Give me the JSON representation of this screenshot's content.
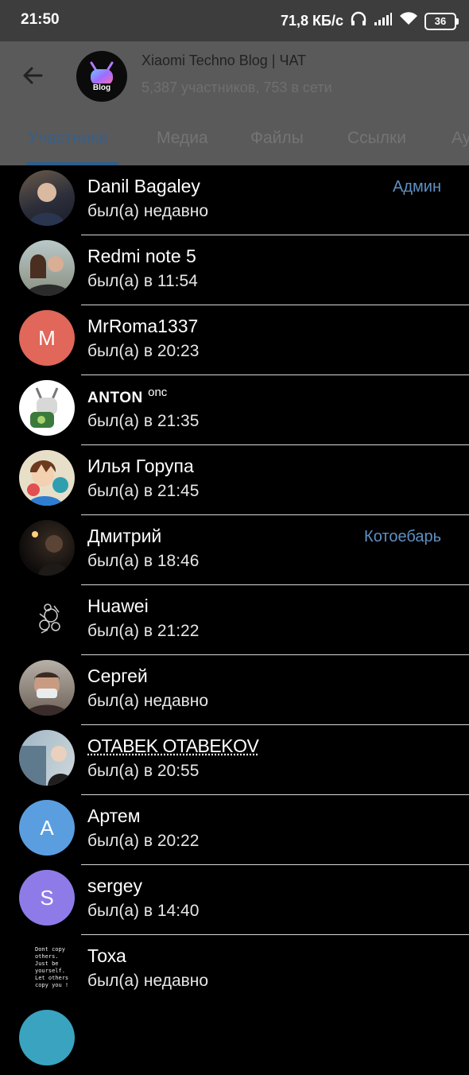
{
  "status_bar": {
    "time": "21:50",
    "network_speed": "71,8 КБ/с",
    "battery_level": "36",
    "icons": [
      "headphones-icon",
      "signal-icon",
      "wifi-icon",
      "battery-icon"
    ]
  },
  "header": {
    "avatar_text": "Blog",
    "title": "Xiaomi Techno Blog | ЧАТ",
    "subtitle": "5,387 участников, 753 в сети"
  },
  "tabs": [
    {
      "label": "Участники",
      "active": true
    },
    {
      "label": "Медиа"
    },
    {
      "label": "Файлы"
    },
    {
      "label": "Ссылки"
    },
    {
      "label": "Ау"
    }
  ],
  "members": [
    {
      "name": "Danil Bagaley",
      "status": "был(а) недавно",
      "role": "Админ"
    },
    {
      "name": "Redmi note 5",
      "status": "был(а) в 11:54",
      "role": ""
    },
    {
      "name": "MrRoma1337",
      "status": "был(а) в 20:23",
      "role": "",
      "initial": "M"
    },
    {
      "name": "ANTON",
      "name_sup": "onc",
      "status": "был(а) в 21:35",
      "role": ""
    },
    {
      "name": "Илья Горупа",
      "status": "был(а) в 21:45",
      "role": ""
    },
    {
      "name": "Дмитрий",
      "status": "был(а) в 18:46",
      "role": "Котоебарь"
    },
    {
      "name": "Huawei",
      "status": "был(а) в 21:22",
      "role": ""
    },
    {
      "name": "Сергей",
      "status": "был(а) недавно",
      "role": ""
    },
    {
      "name": "OTABEK OTABEKOV",
      "status": "был(а) в 20:55",
      "role": ""
    },
    {
      "name": "Артем",
      "status": "был(а) в 20:22",
      "role": "",
      "initial": "A"
    },
    {
      "name": "sergey",
      "status": "был(а) в 14:40",
      "role": "",
      "initial": "S"
    },
    {
      "name": "Тоха",
      "status": "был(а) недавно",
      "role": "",
      "avatar_text": "Dont copy others. Just be yourself. Let others copy you !"
    }
  ],
  "colors": {
    "accent": "#5f90c2",
    "tab_active": "#3a5f86",
    "avatar_m": "#e0675a",
    "avatar_a": "#5a9ee0",
    "avatar_s": "#8f7be8"
  }
}
